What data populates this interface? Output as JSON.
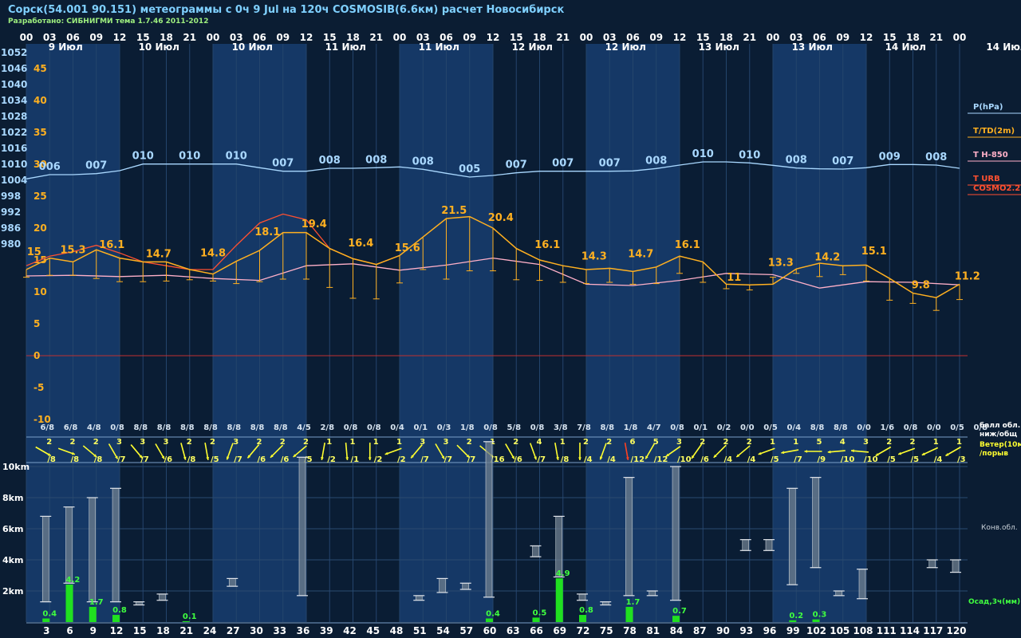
{
  "header": {
    "title": "Сорск(54.001 90.151) метеограммы с  0ч 9 Jul на 120ч COSMOSIB(6.6км) расчет Новосибирск",
    "subtitle": "Разработано: СИБНИГМИ тема 1.7.46 2011-2012"
  },
  "colors": {
    "pressure": "#a9d8ff",
    "temperature": "#ffb020",
    "t850": "#ffb0c8",
    "turb": "#ff5030",
    "wind": "#ffff30",
    "precip": "#20e020",
    "zero_line": "#c03030"
  },
  "chart_data": {
    "type": "line",
    "time_hours": [
      3,
      6,
      9,
      12,
      15,
      18,
      21,
      24,
      27,
      30,
      33,
      36,
      39,
      42,
      45,
      48,
      51,
      54,
      57,
      60,
      63,
      66,
      69,
      72,
      75,
      78,
      81,
      84,
      87,
      90,
      93,
      96,
      99,
      102,
      105,
      108,
      111,
      114,
      117,
      120
    ],
    "hour_labels": [
      "00",
      "03",
      "06",
      "09",
      "12",
      "15",
      "18",
      "21",
      "00",
      "03",
      "06",
      "09",
      "12",
      "15",
      "18",
      "21",
      "00",
      "03",
      "06",
      "09",
      "12",
      "15",
      "18",
      "21",
      "00",
      "03",
      "06",
      "09",
      "12",
      "15",
      "18",
      "21",
      "00",
      "03",
      "06",
      "09",
      "12",
      "15",
      "18",
      "21",
      "00"
    ],
    "day_labels": [
      {
        "text": "9 Июл",
        "h": 3
      },
      {
        "text": "10 Июл",
        "h": 15
      },
      {
        "text": "10 Июл",
        "h": 27
      },
      {
        "text": "11 Июл",
        "h": 39
      },
      {
        "text": "11 Июл",
        "h": 51
      },
      {
        "text": "12 Июл",
        "h": 63
      },
      {
        "text": "12 Июл",
        "h": 75
      },
      {
        "text": "13 Июл",
        "h": 87
      },
      {
        "text": "13 Июл",
        "h": 99
      },
      {
        "text": "14 Июл",
        "h": 111
      },
      {
        "text": "14 Июл",
        "h": 124
      }
    ],
    "pressure_axis_ticks": [
      1052,
      1046,
      1040,
      1034,
      1028,
      1022,
      1016,
      1010,
      1004,
      998,
      992,
      986,
      980
    ],
    "temperature_axis_ticks": [
      45,
      40,
      35,
      30,
      25,
      20,
      15,
      10,
      5,
      0,
      -5,
      -10
    ],
    "height_axis_ticks": [
      "10km",
      "8km",
      "6km",
      "4km",
      "2km"
    ],
    "legend": [
      "P(hPa)",
      "T/TD(2m)",
      "T H-850",
      "T URB",
      "COSMO2.2"
    ],
    "pressure_series": {
      "name": "P(hPa)",
      "h": [
        0,
        3,
        6,
        9,
        12,
        15,
        18,
        21,
        24,
        27,
        30,
        33,
        36,
        39,
        42,
        45,
        48,
        51,
        54,
        57,
        60,
        63,
        66,
        69,
        72,
        75,
        78,
        81,
        84,
        87,
        90,
        93,
        96,
        99,
        102,
        105,
        108,
        111,
        114,
        117,
        120
      ],
      "values": [
        1004.2,
        1005.8,
        1005.8,
        1006.2,
        1007.3,
        1009.8,
        1009.8,
        1009.8,
        1009.8,
        1009.8,
        1008.4,
        1007.1,
        1007.1,
        1008.2,
        1008.2,
        1008.4,
        1008.7,
        1007.8,
        1006.3,
        1004.9,
        1005.5,
        1006.5,
        1007.1,
        1007.1,
        1007.1,
        1007.1,
        1007.2,
        1008.1,
        1009.4,
        1010.6,
        1010.6,
        1010.2,
        1009.3,
        1008.3,
        1008.0,
        1007.9,
        1008.4,
        1009.6,
        1009.6,
        1009.4,
        1008.2
      ],
      "labels": [
        {
          "h": 3,
          "t": "006"
        },
        {
          "h": 9,
          "t": "007"
        },
        {
          "h": 15,
          "t": "010"
        },
        {
          "h": 21,
          "t": "010"
        },
        {
          "h": 27,
          "t": "010"
        },
        {
          "h": 33,
          "t": "007"
        },
        {
          "h": 39,
          "t": "008"
        },
        {
          "h": 45,
          "t": "008"
        },
        {
          "h": 51,
          "t": "008"
        },
        {
          "h": 57,
          "t": "005"
        },
        {
          "h": 63,
          "t": "007"
        },
        {
          "h": 69,
          "t": "007"
        },
        {
          "h": 75,
          "t": "007"
        },
        {
          "h": 81,
          "t": "008"
        },
        {
          "h": 87,
          "t": "010"
        },
        {
          "h": 93,
          "t": "010"
        },
        {
          "h": 99,
          "t": "008"
        },
        {
          "h": 105,
          "t": "007"
        },
        {
          "h": 111,
          "t": "009"
        },
        {
          "h": 117,
          "t": "008"
        }
      ]
    },
    "temperature_series": {
      "name": "T/TD(2m)",
      "h": [
        0,
        3,
        6,
        9,
        12,
        15,
        18,
        21,
        24,
        27,
        30,
        33,
        36,
        39,
        42,
        45,
        48,
        51,
        54,
        57,
        60,
        63,
        66,
        69,
        72,
        75,
        78,
        81,
        84,
        87,
        90,
        93,
        96,
        99,
        102,
        105,
        108,
        111,
        114,
        117,
        120
      ],
      "values": [
        13.5,
        15.3,
        14.7,
        16.6,
        15.3,
        14.7,
        14.7,
        13.5,
        12.8,
        14.8,
        16.5,
        19.3,
        19.3,
        16.8,
        15.2,
        14.3,
        15.7,
        18.6,
        21.5,
        21.8,
        20.0,
        16.8,
        15.0,
        14.1,
        13.5,
        13.7,
        13.2,
        13.9,
        15.6,
        14.7,
        11.2,
        11.1,
        11.2,
        13.6,
        14.5,
        14.1,
        14.2,
        12.1,
        9.8,
        9.1,
        11.2
      ],
      "td_values": [
        12.3,
        12.6,
        12.6,
        12.1,
        11.6,
        11.6,
        11.7,
        11.9,
        11.7,
        11.3,
        11.6,
        12.0,
        12.0,
        10.7,
        9.0,
        8.9,
        11.4,
        13.5,
        12.0,
        13.3,
        13.3,
        11.9,
        11.8,
        11.5,
        11.3,
        11.5,
        11.2,
        11.3,
        12.9,
        11.5,
        10.5,
        10.3,
        12.3,
        12.9,
        12.4,
        12.7,
        11.7,
        8.7,
        8.2,
        7.1,
        8.8
      ],
      "labels": [
        {
          "h": 1,
          "t": "15"
        },
        {
          "h": 6,
          "t": "15.3"
        },
        {
          "h": 11,
          "t": "16.1"
        },
        {
          "h": 17,
          "t": "14.7"
        },
        {
          "h": 24,
          "t": "14.8"
        },
        {
          "h": 31,
          "t": "18.1"
        },
        {
          "h": 37,
          "t": "19.4"
        },
        {
          "h": 43,
          "t": "16.4"
        },
        {
          "h": 49,
          "t": "15.6"
        },
        {
          "h": 55,
          "t": "21.5"
        },
        {
          "h": 61,
          "t": "20.4"
        },
        {
          "h": 67,
          "t": "16.1"
        },
        {
          "h": 73,
          "t": "14.3"
        },
        {
          "h": 79,
          "t": "14.7"
        },
        {
          "h": 85,
          "t": "16.1"
        },
        {
          "h": 91,
          "t": "11"
        },
        {
          "h": 97,
          "t": "13.3"
        },
        {
          "h": 103,
          "t": "14.2"
        },
        {
          "h": 109,
          "t": "15.1"
        },
        {
          "h": 115,
          "t": "9.8"
        },
        {
          "h": 121,
          "t": "11.2"
        }
      ]
    },
    "t850_series": {
      "name": "T H-850",
      "h": [
        0,
        6,
        12,
        18,
        24,
        30,
        36,
        42,
        48,
        54,
        60,
        66,
        72,
        78,
        84,
        90,
        96,
        102,
        108,
        114,
        120
      ],
      "values": [
        12.5,
        12.6,
        12.4,
        12.6,
        12.1,
        11.8,
        14.1,
        14.4,
        13.4,
        14.2,
        15.3,
        14.3,
        11.2,
        11.0,
        11.8,
        12.9,
        12.7,
        10.6,
        11.6,
        11.5,
        11.1
      ]
    },
    "turb_series": {
      "name": "T URB",
      "h": [
        0,
        3,
        6,
        9,
        12,
        15,
        18,
        21,
        24,
        27,
        30,
        33,
        36,
        39,
        42,
        45,
        48
      ],
      "values": [
        14.1,
        15.6,
        16.3,
        17.3,
        16.1,
        14.7,
        14.1,
        13.5,
        13.5,
        17.3,
        20.8,
        22.2,
        21.3,
        16.8,
        15.2,
        14.3,
        15.7
      ]
    },
    "cloud_labels": [
      "6/8",
      "6/8",
      "4/8",
      "0/8",
      "8/8",
      "8/8",
      "8/8",
      "8/8",
      "8/8",
      "8/8",
      "8/8",
      "4/5",
      "2/8",
      "0/8",
      "0/8",
      "0/4",
      "0/1",
      "0/3",
      "1/8",
      "0/8",
      "5/8",
      "0/8",
      "3/8",
      "7/8",
      "8/8",
      "1/8",
      "4/7",
      "0/8",
      "0/1",
      "0/2",
      "0/0",
      "0/5",
      "0/4",
      "8/8",
      "8/8",
      "0/0",
      "1/6",
      "0/8",
      "0/0",
      "0/5",
      "0/8"
    ],
    "cloud_axis_label": [
      "балл обл.",
      "ниж/общ"
    ],
    "wind": {
      "axis_label": [
        "Ветер(10м)",
        "/порыв"
      ],
      "speed": [
        2,
        2,
        2,
        3,
        3,
        3,
        2,
        2,
        3,
        2,
        2,
        2,
        1,
        1,
        1,
        1,
        3,
        3,
        2,
        1,
        2,
        4,
        1,
        2,
        2,
        6,
        5,
        3,
        2,
        2,
        2,
        1,
        1,
        5,
        4,
        3,
        2,
        2,
        1,
        1
      ],
      "gust": [
        "/8",
        "/8",
        "/8",
        "/7",
        "/7",
        "/6",
        "/8",
        "/5",
        "/7",
        "/6",
        "/6",
        "/5",
        "/2",
        "/1",
        "/2",
        "/2",
        "/7",
        "/7",
        "/7",
        "/16",
        "/6",
        "/7",
        "/8",
        "/4",
        "/4",
        "/12",
        "/12",
        "/10",
        "/6",
        "/4",
        "/4",
        "/5",
        "/7",
        "/9",
        "/10",
        "/10",
        "/5",
        "/5",
        "/4",
        "/3"
      ],
      "dir": [
        120,
        110,
        130,
        150,
        140,
        150,
        165,
        170,
        200,
        220,
        225,
        230,
        190,
        175,
        180,
        250,
        220,
        150,
        135,
        130,
        150,
        160,
        170,
        180,
        200,
        170,
        210,
        235,
        215,
        225,
        230,
        250,
        260,
        270,
        265,
        275,
        240,
        250,
        245,
        240
      ]
    },
    "convective_clouds": {
      "axis_label": "Конв.обл.",
      "items": [
        {
          "h": 3,
          "base": 1.3,
          "top": 6.8
        },
        {
          "h": 6,
          "base": 2.5,
          "top": 7.4
        },
        {
          "h": 9,
          "base": 1.3,
          "top": 8.0
        },
        {
          "h": 12,
          "base": 1.3,
          "top": 8.6
        },
        {
          "h": 15,
          "base": 1.1,
          "top": 1.3
        },
        {
          "h": 18,
          "base": 1.4,
          "top": 1.8
        },
        {
          "h": 27,
          "base": 2.3,
          "top": 2.8
        },
        {
          "h": 36,
          "base": 1.7,
          "top": 10.6
        },
        {
          "h": 51,
          "base": 1.4,
          "top": 1.7
        },
        {
          "h": 54,
          "base": 1.9,
          "top": 2.8
        },
        {
          "h": 57,
          "base": 2.1,
          "top": 2.5
        },
        {
          "h": 60,
          "base": 1.6,
          "top": 11.6
        },
        {
          "h": 66,
          "base": 4.2,
          "top": 4.9
        },
        {
          "h": 69,
          "base": 2.9,
          "top": 6.8
        },
        {
          "h": 72,
          "base": 1.4,
          "top": 1.8
        },
        {
          "h": 75,
          "base": 1.1,
          "top": 1.3
        },
        {
          "h": 78,
          "base": 1.7,
          "top": 9.3
        },
        {
          "h": 81,
          "base": 1.7,
          "top": 2.0
        },
        {
          "h": 84,
          "base": 1.4,
          "top": 10.0
        },
        {
          "h": 93,
          "base": 4.6,
          "top": 5.3
        },
        {
          "h": 96,
          "base": 4.6,
          "top": 5.3
        },
        {
          "h": 99,
          "base": 2.4,
          "top": 8.6
        },
        {
          "h": 102,
          "base": 3.5,
          "top": 9.3
        },
        {
          "h": 105,
          "base": 1.7,
          "top": 2.0
        },
        {
          "h": 108,
          "base": 1.5,
          "top": 3.4
        },
        {
          "h": 117,
          "base": 3.5,
          "top": 4.0
        },
        {
          "h": 120,
          "base": 3.2,
          "top": 4.0
        }
      ]
    },
    "precip": {
      "axis_label": "Осад,3ч(мм)",
      "items": [
        {
          "h": 3,
          "v": 0.4
        },
        {
          "h": 6,
          "v": 4.2
        },
        {
          "h": 9,
          "v": 1.7
        },
        {
          "h": 12,
          "v": 0.8
        },
        {
          "h": 21,
          "v": 0.1
        },
        {
          "h": 60,
          "v": 0.4
        },
        {
          "h": 66,
          "v": 0.5
        },
        {
          "h": 69,
          "v": 4.9
        },
        {
          "h": 72,
          "v": 0.8
        },
        {
          "h": 78,
          "v": 1.7
        },
        {
          "h": 84,
          "v": 0.7
        },
        {
          "h": 99,
          "v": 0.2
        },
        {
          "h": 102,
          "v": 0.3
        }
      ]
    }
  }
}
